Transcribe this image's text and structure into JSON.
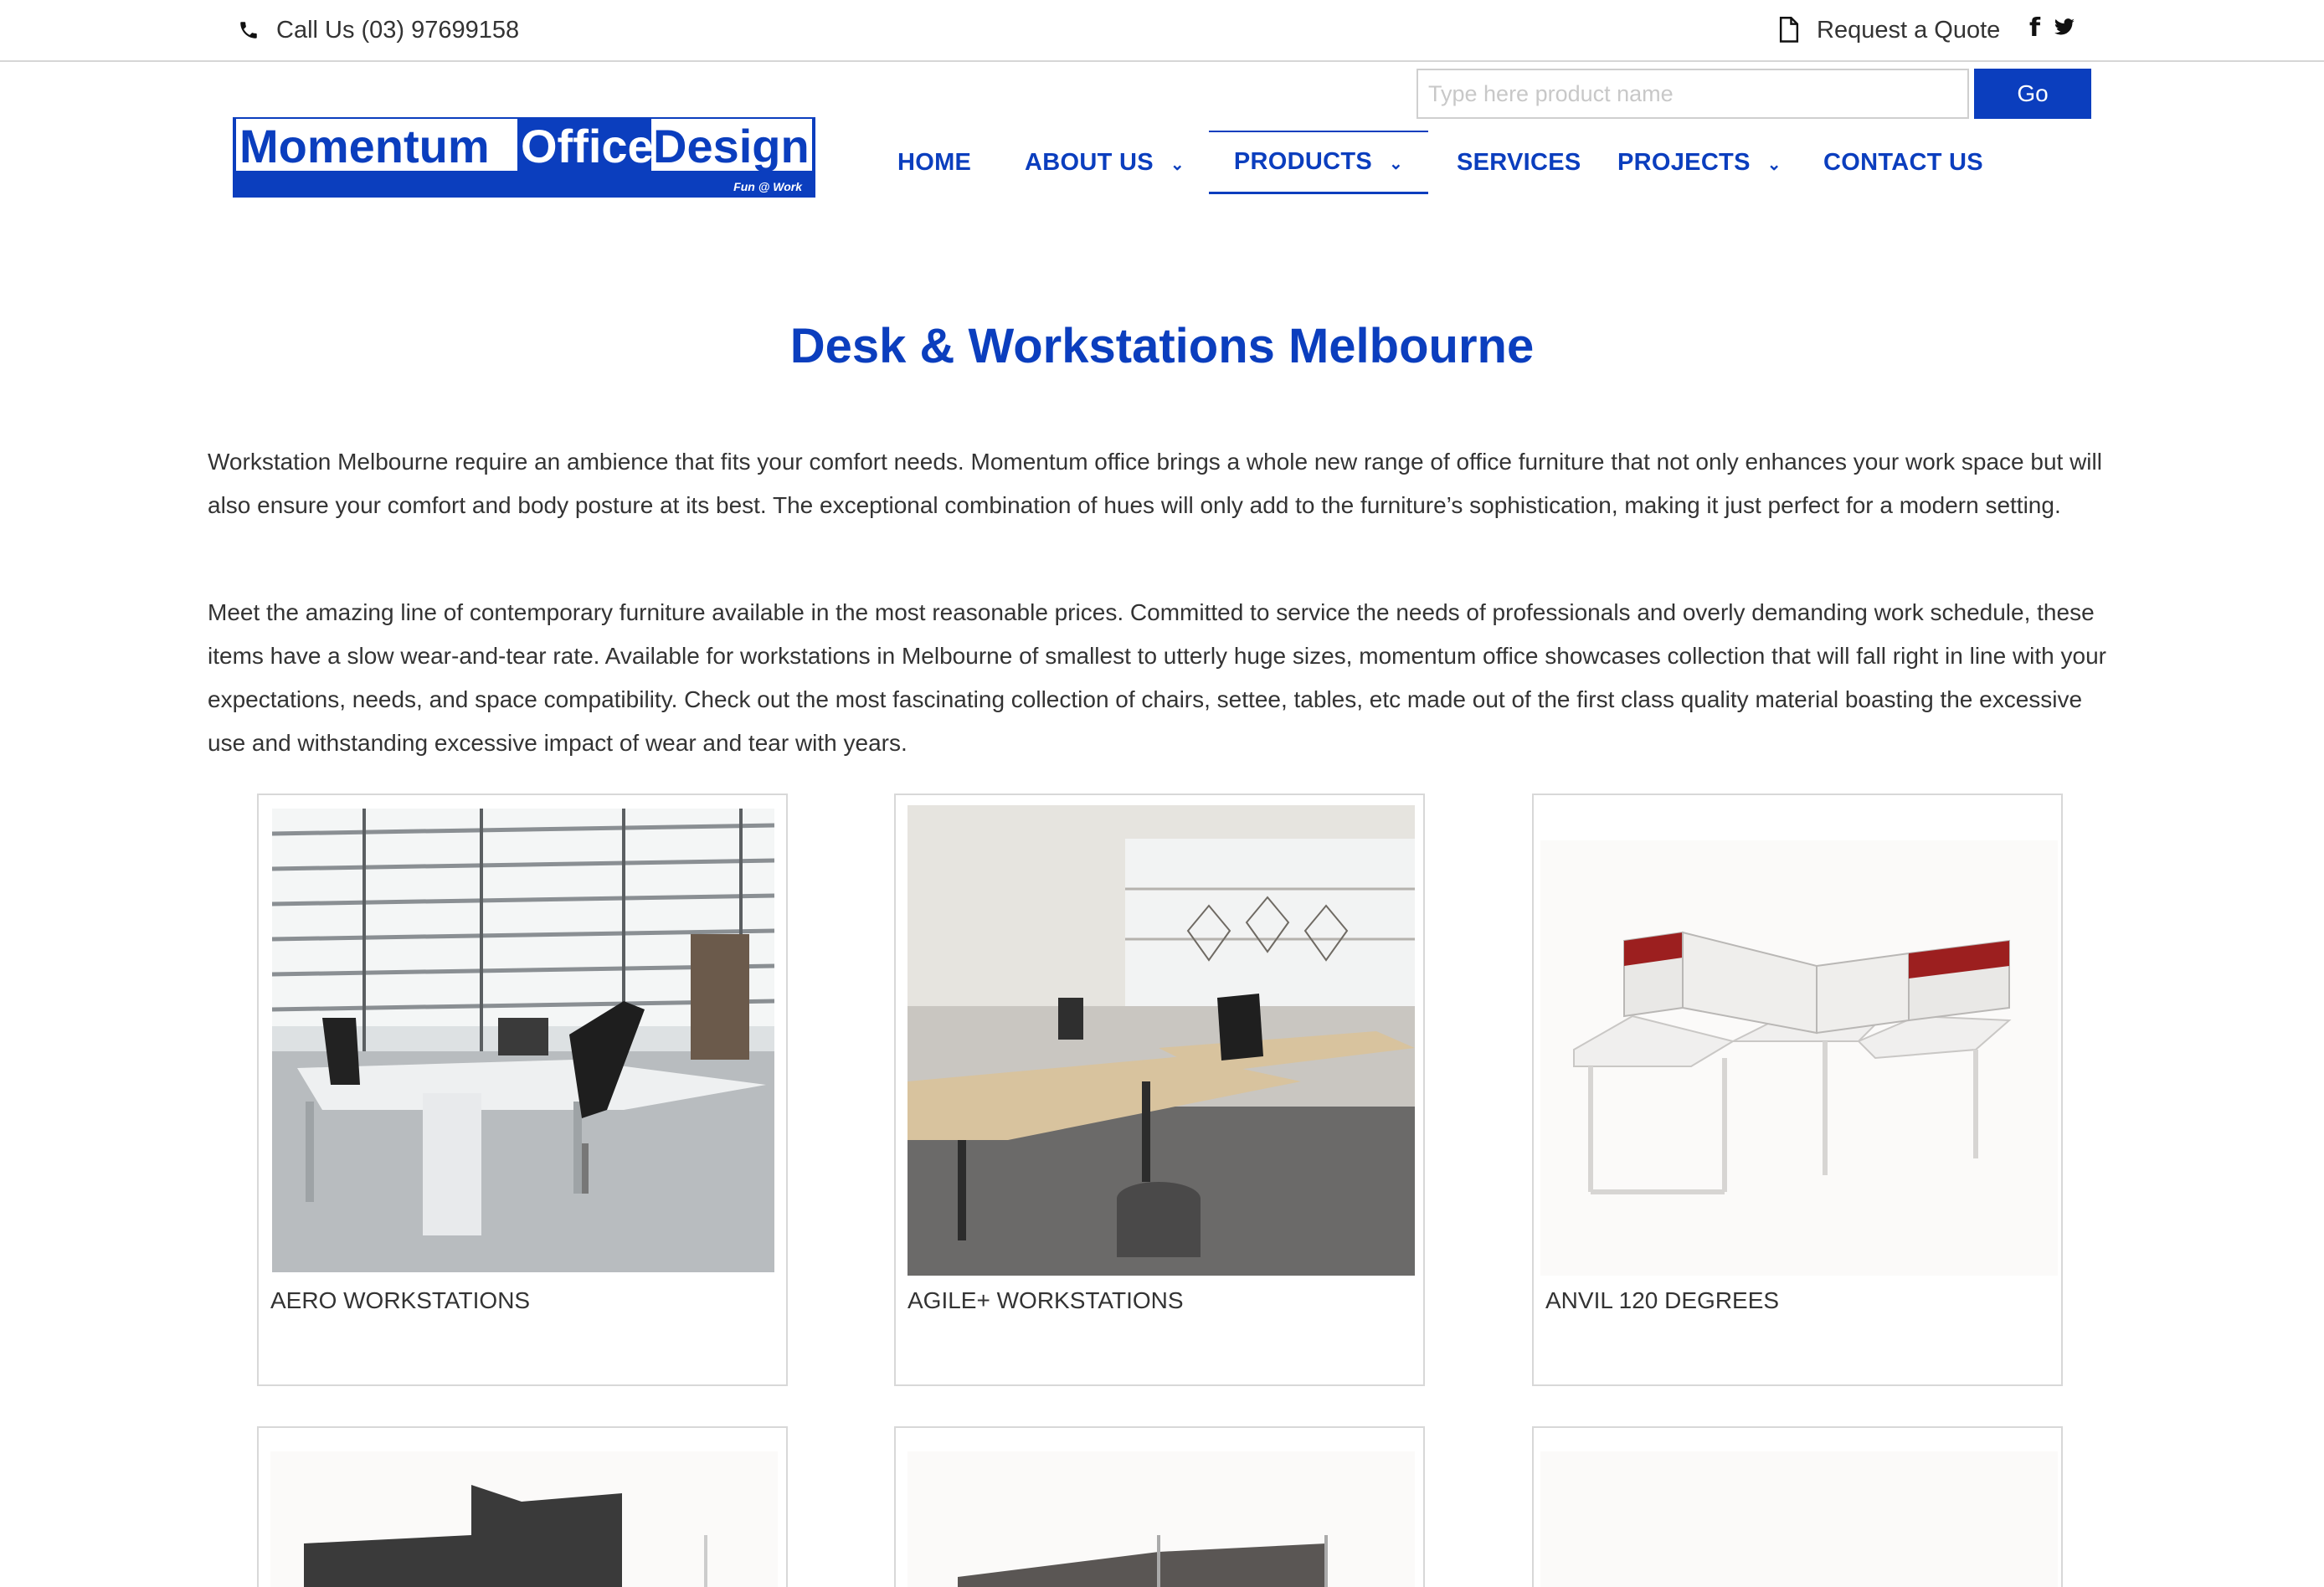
{
  "topbar": {
    "phone_label": "Call Us (03) 97699158",
    "quote_label": "Request a Quote",
    "facebook_glyph": "f",
    "twitter_icon": "twitter-icon"
  },
  "logo": {
    "word1": "Momentum",
    "word2": "Office",
    "word3": "Design",
    "tagline": "Fun @ Work",
    "brand_color": "#0b3ebe"
  },
  "search": {
    "placeholder": "Type here product name",
    "value": "",
    "button_label": "Go"
  },
  "nav": {
    "home": "HOME",
    "about": "ABOUT US",
    "products": "PRODUCTS",
    "services": "SERVICES",
    "projects": "PROJECTS",
    "contact": "CONTACT US",
    "active": "PRODUCTS"
  },
  "page": {
    "title": "Desk & Workstations Melbourne",
    "paragraph1": "Workstation Melbourne require an ambience that fits your comfort needs. Momentum office brings a whole new range of office furniture that not only enhances your work space but will also ensure your comfort and body posture at its best. The exceptional combination of hues will only add to the furniture’s sophistication, making it just perfect for a modern setting.",
    "paragraph2": "Meet the amazing line of contemporary furniture available in the most reasonable prices. Committed to service the needs of professionals and overly demanding work schedule, these items have a slow wear-and-tear rate. Available for workstations in Melbourne of smallest to utterly huge sizes, momentum office showcases collection that will fall right in line with your expectations, needs, and space compatibility. Check out the most fascinating collection of chairs, settee, tables, etc made out of the first class quality material boasting the excessive use and withstanding excessive impact of wear and tear with years."
  },
  "products": [
    {
      "name": "AERO WORKSTATIONS"
    },
    {
      "name": "AGILE+ WORKSTATIONS"
    },
    {
      "name": "ANVIL 120 DEGREES"
    }
  ],
  "colors": {
    "accent": "#0b3ebe",
    "text": "#333333",
    "border": "#d8d8d8"
  }
}
